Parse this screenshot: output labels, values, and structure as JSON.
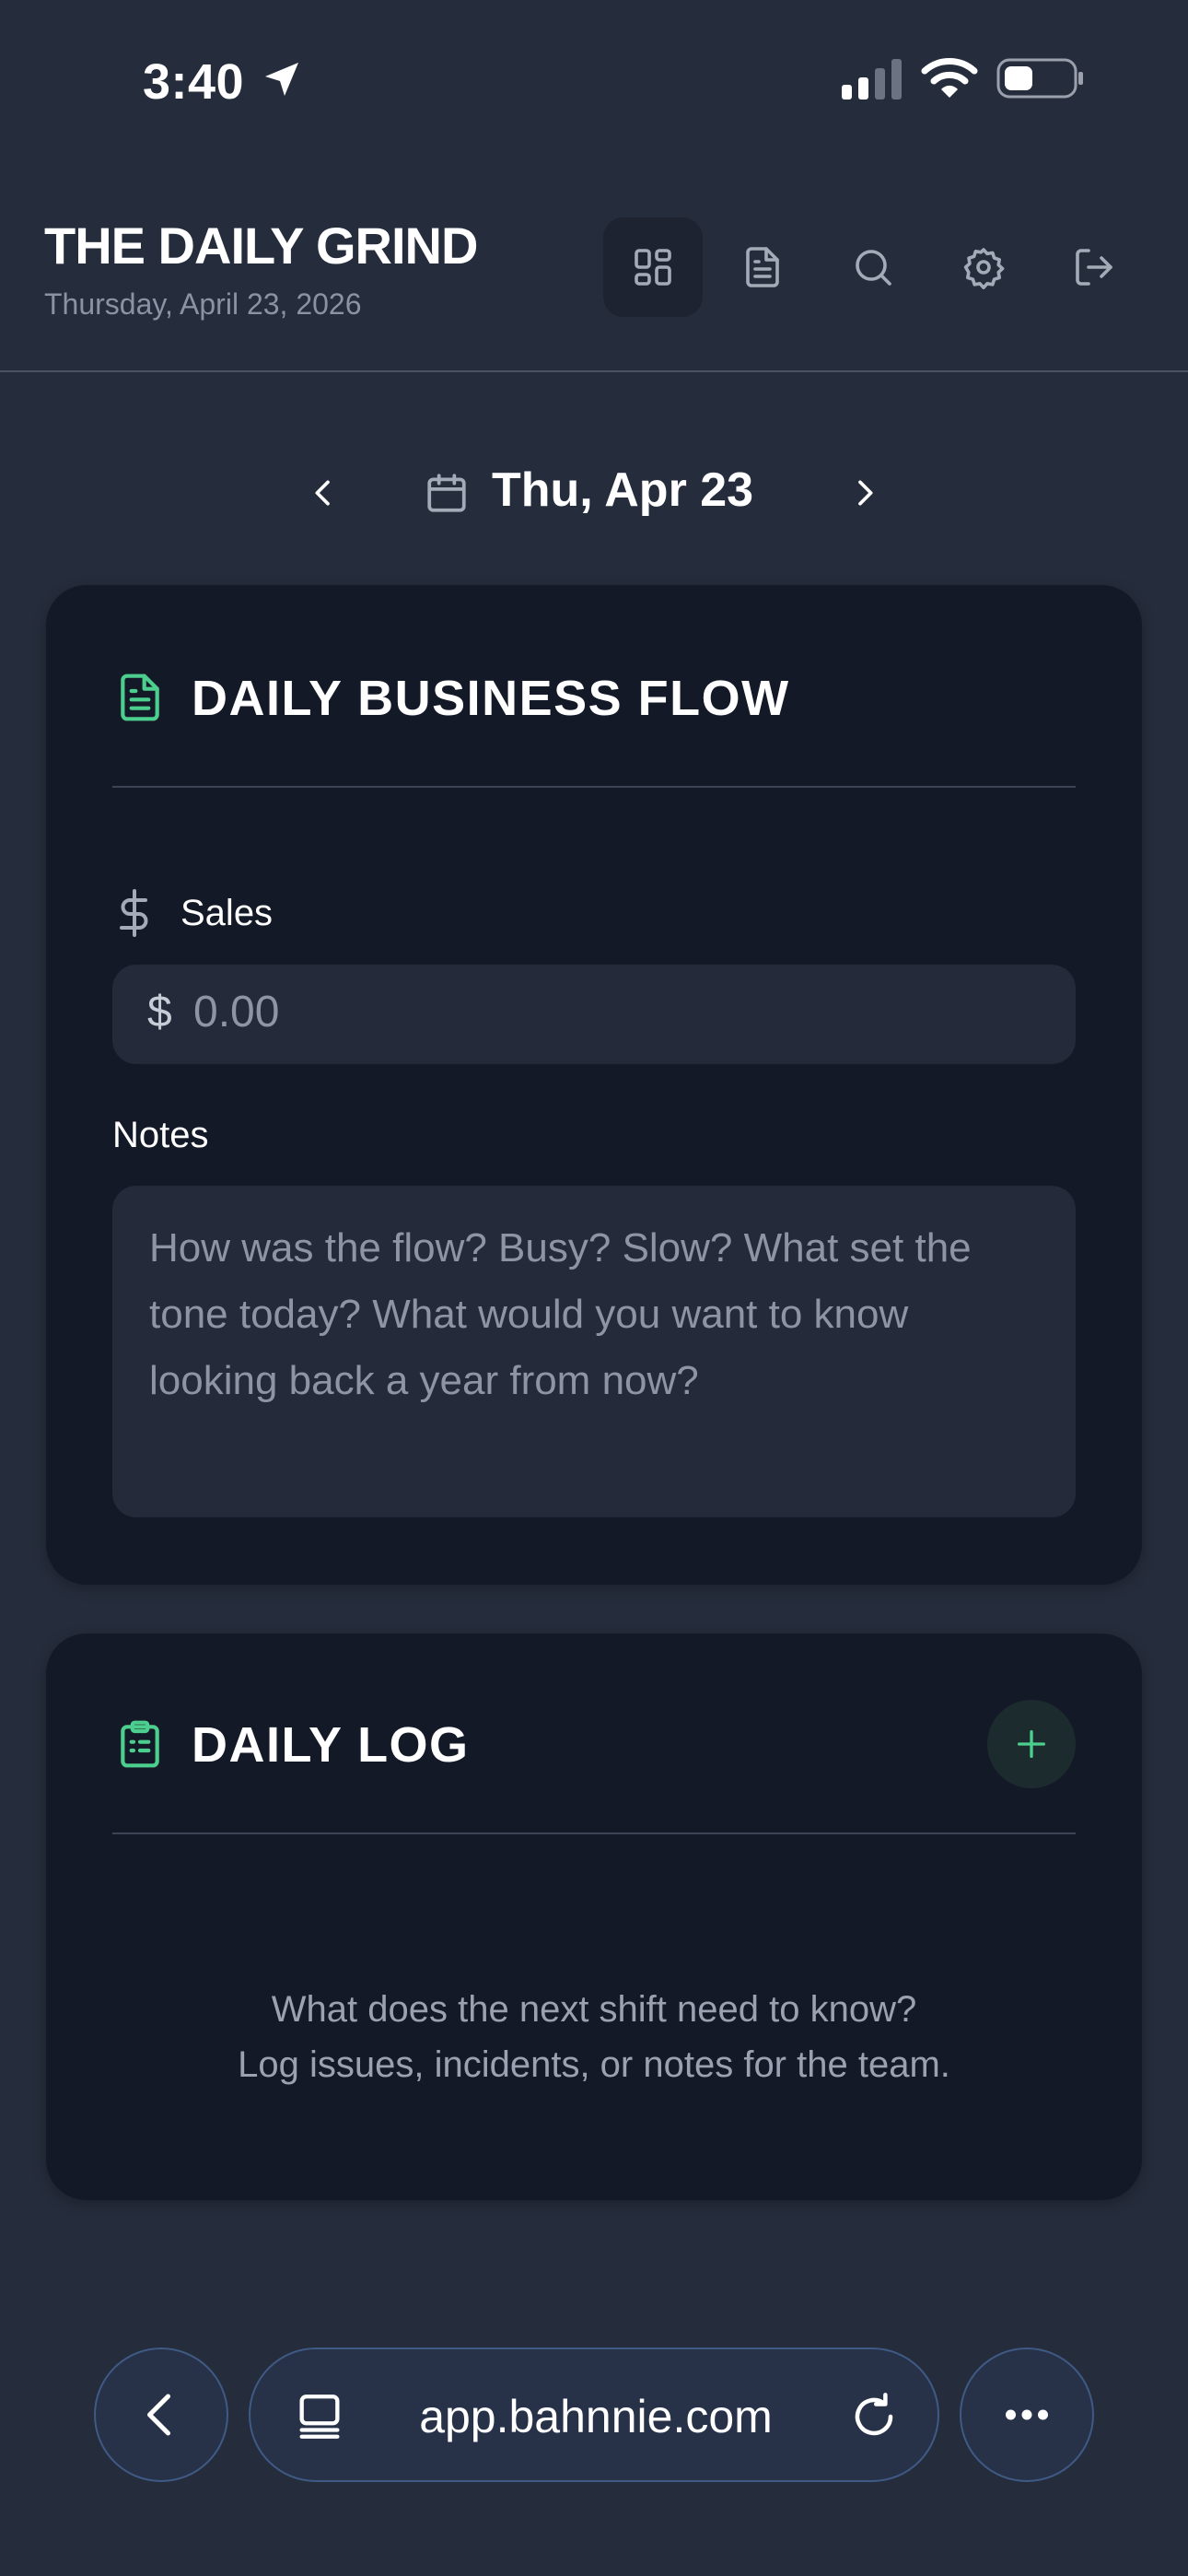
{
  "status_bar": {
    "time": "3:40"
  },
  "header": {
    "title": "THE DAILY GRIND",
    "date": "Thursday, April 23, 2026",
    "nav_icons": [
      "dashboard-icon",
      "document-icon",
      "search-icon",
      "gear-icon",
      "logout-icon"
    ]
  },
  "date_nav": {
    "label": "Thu, Apr 23"
  },
  "flow_card": {
    "title": "DAILY BUSINESS FLOW",
    "sales_label": "Sales",
    "sales_prefix": "$",
    "sales_value": "0.00",
    "notes_label": "Notes",
    "notes_placeholder": "How was the flow? Busy? Slow? What set the tone today? What would you want to know looking back a year from now?"
  },
  "log_card": {
    "title": "DAILY LOG",
    "empty_line1": "What does the next shift need to know?",
    "empty_line2": "Log issues, incidents, or notes for the team."
  },
  "browser": {
    "url": "app.bahnnie.com"
  },
  "colors": {
    "background": "#252c3b",
    "card": "#141927",
    "accent": "#4ccf8e",
    "input": "#242a39"
  }
}
